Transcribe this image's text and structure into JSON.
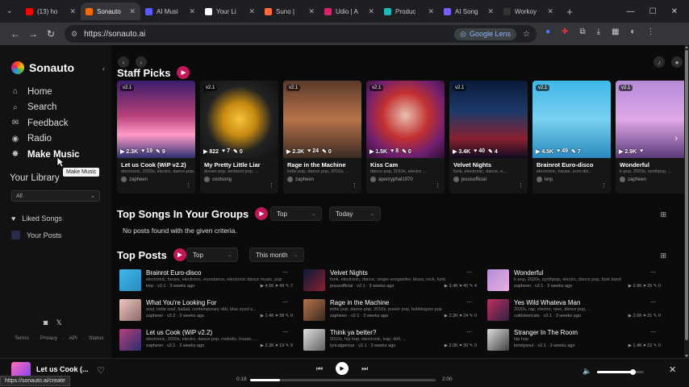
{
  "browser": {
    "tabs": [
      {
        "title": "(13) ho",
        "color": "#ff0000",
        "active": false
      },
      {
        "title": "Sonauto",
        "color": "#ff6a00",
        "active": true
      },
      {
        "title": "AI Musi",
        "color": "#5b5bff",
        "active": false
      },
      {
        "title": "Your Li",
        "color": "#ffffff",
        "active": false
      },
      {
        "title": "Suno |",
        "color": "#ff6a3d",
        "active": false
      },
      {
        "title": "Udio | A",
        "color": "#d6246e",
        "active": false
      },
      {
        "title": "Produc",
        "color": "#1db9b9",
        "active": false
      },
      {
        "title": "AI Song",
        "color": "#7a5cff",
        "active": false
      },
      {
        "title": "Workoy",
        "color": "#333333",
        "active": false
      }
    ],
    "new_tab": "+",
    "url": "https://sonauto.ai",
    "lens_label": "Google Lens"
  },
  "sidebar": {
    "brand": "Sonauto",
    "nav": [
      {
        "icon": "⌂",
        "label": "Home",
        "bold": false
      },
      {
        "icon": "⌕",
        "label": "Search",
        "bold": false
      },
      {
        "icon": "✉",
        "label": "Feedback",
        "bold": false
      },
      {
        "icon": "◉",
        "label": "Radio",
        "bold": false
      },
      {
        "icon": "✸",
        "label": "Make Music",
        "bold": true
      }
    ],
    "library_title": "Your Library",
    "tooltip": "Make Music",
    "filter_value": "All",
    "library_items": [
      "Liked Songs",
      "Your Posts"
    ],
    "footer_links": [
      "Terms",
      "Privacy",
      "API",
      "Status"
    ]
  },
  "staff_picks": {
    "title": "Staff Picks",
    "cards": [
      {
        "ver": "v2.1",
        "plays": "▶ 2.3K",
        "likes": "♥ 19",
        "comments": "✎ 9",
        "title": "Let us Cook (WiP v2.2)",
        "tags": "electronic, 2020s, electro, dance-pop, ...",
        "user": "zapheen",
        "bg": "linear-gradient(180deg,#3a1d6b 0%,#b6407a 45%,#ff9ac8 70%,#2b2f70 100%)"
      },
      {
        "ver": "v2.1",
        "plays": "▶ 822",
        "likes": "♥ 7",
        "comments": "✎ 0",
        "title": "My Pretty Little Liar",
        "tags": "dream pop, ambient pop, ...",
        "user": "coolsong",
        "bg": "radial-gradient(circle at 50% 50%,#f6c23a 0%,#c78a10 30%,#222 60%,#111 100%)"
      },
      {
        "ver": "v2.1",
        "plays": "▶ 2.3K",
        "likes": "♥ 24",
        "comments": "✎ 0",
        "title": "Rage in the Machine",
        "tags": "indie pop, dance pop, 2010s, ...",
        "user": "zapheen",
        "bg": "linear-gradient(180deg,#5a3a2a 0%,#b8734a 50%,#3a2a22 100%)"
      },
      {
        "ver": "v2.1",
        "plays": "▶ 1.5K",
        "likes": "♥ 8",
        "comments": "✎ 0",
        "title": "Kiss Cam",
        "tags": "dance pop, 2010s, electro ...",
        "user": "apocryphal1970",
        "bg": "radial-gradient(circle at 50% 45%,#e8c0b0 0%,#c23030 40%,#702070 70%,#2a1030 100%)"
      },
      {
        "ver": "v2.1",
        "plays": "▶ 3.4K",
        "likes": "♥ 40",
        "comments": "✎ 4",
        "title": "Velvet Nights",
        "tags": "funk, electronic, dance, e...",
        "user": "jesusofficial",
        "bg": "linear-gradient(180deg,#0a1a3a 0%,#1c3a6a 40%,#8a2030 75%,#120a20 100%)"
      },
      {
        "ver": "v2.1",
        "plays": "▶ 4.5K",
        "likes": "♥ 49",
        "comments": "✎ 7",
        "title": "Brainrot Euro-disco",
        "tags": "electronic, house, euro dis...",
        "user": "lerp",
        "bg": "linear-gradient(180deg,#3fb8e8 0%,#7ad0f0 50%,#2a8ac0 100%)"
      },
      {
        "ver": "v2.1",
        "plays": "▶ 2.9K",
        "likes": "♥",
        "comments": "",
        "title": "Wonderful",
        "tags": "k-pop, 2020s, synthpop, ...",
        "user": "zapheen",
        "bg": "linear-gradient(180deg,#b48ad8 0%,#e0a8e8 50%,#5a3a7a 100%)"
      }
    ]
  },
  "groups": {
    "title": "Top Songs In Your Groups",
    "sort": "Top",
    "period": "Today",
    "empty_text": "No posts found with the given criteria."
  },
  "top_posts": {
    "title": "Top Posts",
    "sort": "Top",
    "period": "This month",
    "items": [
      {
        "title": "Brainrot Euro-disco",
        "tags": "electronic, house, electronic, eurodance, electronic dance music, pop",
        "user": "lerp",
        "meta": "v2.1 · 3 weeks ago",
        "stats": "▶ 4.5K ♥ 49 ✎ 7",
        "bg": "linear-gradient(135deg,#3fb8e8,#2a8ac0)"
      },
      {
        "title": "Velvet Nights",
        "tags": "funk, electronic, dance, singer-songwriter, blues, rock, funk",
        "user": "jesusofficial",
        "meta": "v2.1 · 3 weeks ago",
        "stats": "▶ 3.4K ♥ 40 ✎ 4",
        "bg": "linear-gradient(135deg,#0a1a3a,#8a2030)"
      },
      {
        "title": "Wonderful",
        "tags": "k-pop, 2020s, synthpop, electro, dance pop, funk band",
        "user": "zapheen",
        "meta": "v2.1 · 3 weeks ago",
        "stats": "▶ 2.9K ♥ 35 ✎ 0",
        "bg": "linear-gradient(135deg,#b48ad8,#e8b0e0)"
      },
      {
        "title": "What You're Looking For",
        "tags": "soul, indie soul, ballad, contemporary r&b, blue eyed s...",
        "user": "zapheen",
        "meta": "v2.2 · 3 weeks ago",
        "stats": "▶ 1.4K ♥ 38 ✎ 0",
        "bg": "linear-gradient(135deg,#f0c8c0,#8a6a6a)"
      },
      {
        "title": "Rage in the Machine",
        "tags": "indie pop, dance pop, 2010s, power pop, bubblegum pop",
        "user": "zapheen",
        "meta": "v2.1 · 3 weeks ago",
        "stats": "▶ 2.3K ♥ 24 ✎ 0",
        "bg": "linear-gradient(135deg,#b8734a,#3a2a22)"
      },
      {
        "title": "Yes Wild Whateva Man",
        "tags": "2020s, rap, electro, rave, dance pop, ...",
        "user": "coldsteelcats",
        "meta": "v2.1 · 3 weeks ago",
        "stats": "▶ 2.6K ♥ 31 ✎ 0",
        "bg": "linear-gradient(135deg,#c03060,#302040)"
      },
      {
        "title": "Let us Cook (WiP v2.2)",
        "tags": "electronic, 2020s, electro, dance-pop, melodic, house, ...",
        "user": "zapheen",
        "meta": "v2.1 · 3 weeks ago",
        "stats": "▶ 2.3K ♥ 19 ✎ 9",
        "bg": "linear-gradient(135deg,#b6407a,#2b2f70)"
      },
      {
        "title": "Think ya better?",
        "tags": "2010s, hip hop, electronic, trap, drill, ...",
        "user": "lyricalgenius",
        "meta": "v2.1 · 3 weeks ago",
        "stats": "▶ 2.0K ♥ 30 ✎ 0",
        "bg": "linear-gradient(135deg,#e0e0e0,#606060)"
      },
      {
        "title": "Stranger In The Room",
        "tags": "hip hop",
        "user": "lonelysoul",
        "meta": "v2.1 · 3 weeks ago",
        "stats": "▶ 1.4K ♥ 22 ✎ 0",
        "bg": "linear-gradient(135deg,#dcdcdc,#404040)"
      }
    ]
  },
  "player": {
    "now_playing": "Let us Cook (...",
    "current_time": "0:18",
    "duration": "2:00",
    "progress": 0.16,
    "volume": 0.78
  },
  "status_url": "https://sonauto.ai/create"
}
